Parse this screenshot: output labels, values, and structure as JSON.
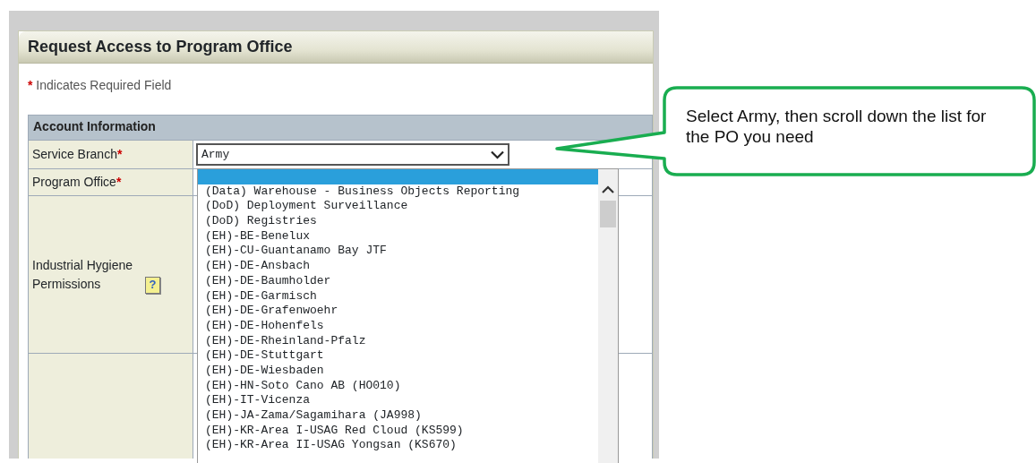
{
  "panel": {
    "title": "Request Access to Program Office"
  },
  "required_note": {
    "mark": "*",
    "text": "Indicates Required Field"
  },
  "section": {
    "title": "Account Information"
  },
  "fields": [
    {
      "kind": "select",
      "label": "Service Branch",
      "required": true,
      "value": "Army"
    },
    {
      "kind": "listbox",
      "label": "Program Office",
      "required": true
    },
    {
      "kind": "help",
      "label": "Industrial Hygiene Permissions",
      "required": false,
      "help_icon": "?"
    },
    {
      "kind": "blank"
    }
  ],
  "program_office_options": [
    {
      "selected": true
    },
    {
      "label": "(Data) Warehouse - Business Objects Reporting",
      "selected": false
    },
    {
      "label": "(DoD) Deployment Surveillance",
      "selected": false
    },
    {
      "label": "(DoD) Registries",
      "selected": false
    },
    {
      "label": "(EH)-BE-Benelux",
      "selected": false
    },
    {
      "label": "(EH)-CU-Guantanamo Bay JTF",
      "selected": false
    },
    {
      "label": "(EH)-DE-Ansbach",
      "selected": false
    },
    {
      "label": "(EH)-DE-Baumholder",
      "selected": false
    },
    {
      "label": "(EH)-DE-Garmisch",
      "selected": false
    },
    {
      "label": "(EH)-DE-Grafenwoehr",
      "selected": false
    },
    {
      "label": "(EH)-DE-Hohenfels",
      "selected": false
    },
    {
      "label": "(EH)-DE-Rheinland-Pfalz",
      "selected": false
    },
    {
      "label": "(EH)-DE-Stuttgart",
      "selected": false
    },
    {
      "label": "(EH)-DE-Wiesbaden",
      "selected": false
    },
    {
      "label": "(EH)-HN-Soto Cano AB (HO010)",
      "selected": false
    },
    {
      "label": "(EH)-IT-Vicenza",
      "selected": false
    },
    {
      "label": "(EH)-JA-Zama/Sagamihara (JA998)",
      "selected": false
    },
    {
      "label": "(EH)-KR-Area I-USAG Red Cloud (KS599)",
      "selected": false
    },
    {
      "label": "(EH)-KR-Area II-USAG Yongsan (KS670)",
      "selected": false
    }
  ],
  "callout": {
    "text": "Select Army, then scroll down the list for the PO you need"
  }
}
